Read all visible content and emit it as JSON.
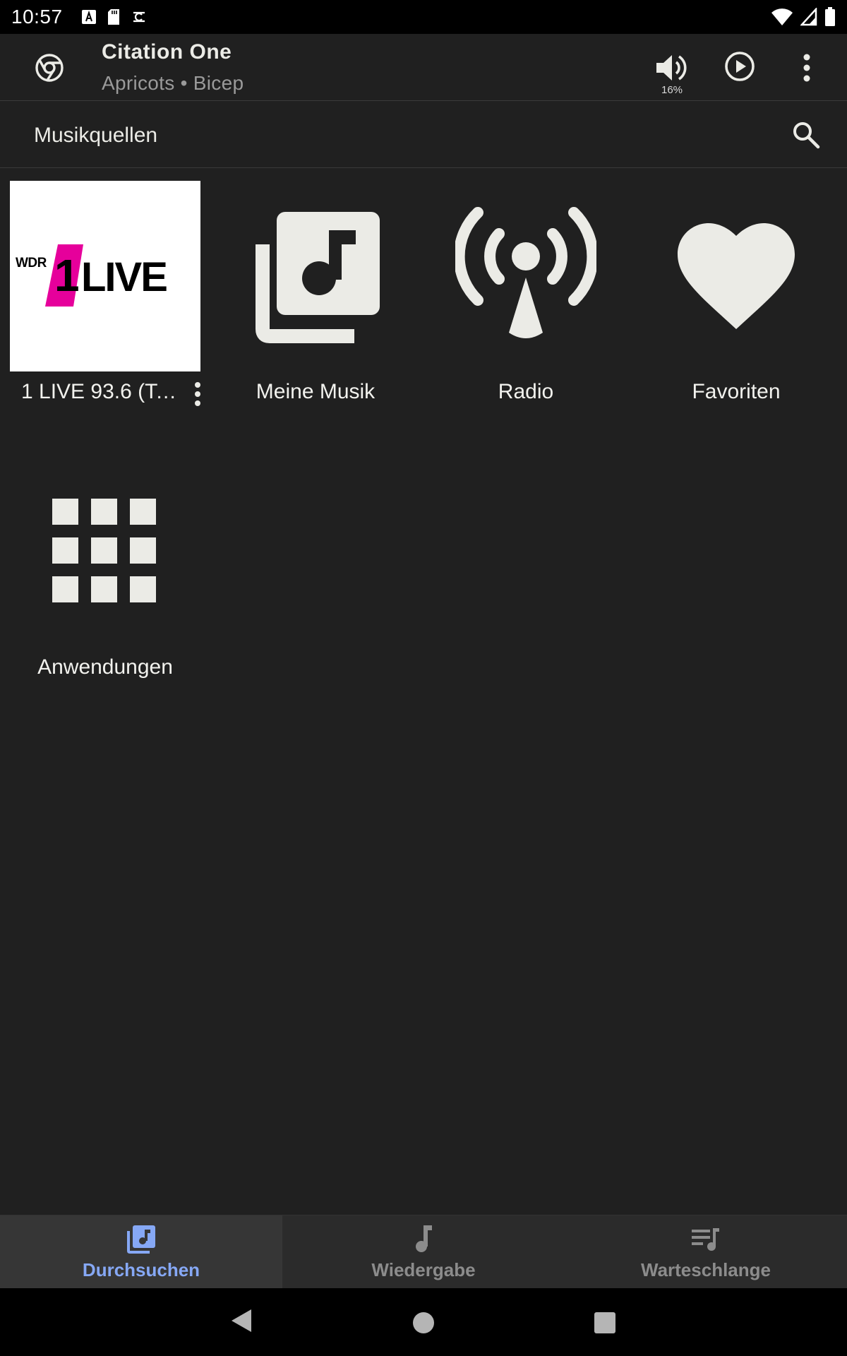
{
  "status_bar": {
    "time": "10:57",
    "icons_left": [
      "a-icon",
      "sd-card-icon",
      "sync-icon"
    ],
    "icons_right": [
      "wifi-icon",
      "signal-icon",
      "battery-icon"
    ]
  },
  "now_playing": {
    "title": "Citation One",
    "subtitle": "Apricots • Bicep",
    "volume_label": "16%"
  },
  "section": {
    "title": "Musikquellen"
  },
  "sources": [
    {
      "label": "1 LIVE 93.6 (To…",
      "icon": "1live-logo",
      "logo_text_wdr": "WDR",
      "logo_text_one": "1",
      "logo_text_live": "LIVE"
    },
    {
      "label": "Meine Musik",
      "icon": "music-library-icon"
    },
    {
      "label": "Radio",
      "icon": "radio-tower-icon"
    },
    {
      "label": "Favoriten",
      "icon": "heart-icon"
    },
    {
      "label": "Anwendungen",
      "icon": "apps-grid-icon"
    }
  ],
  "bottom_nav": [
    {
      "label": "Durchsuchen",
      "active": true
    },
    {
      "label": "Wiedergabe",
      "active": false
    },
    {
      "label": "Warteschlange",
      "active": false
    }
  ],
  "colors": {
    "background": "#202020",
    "icon": "#ebebe6",
    "accent": "#86a8f5",
    "logo_pink": "#e6009b"
  }
}
